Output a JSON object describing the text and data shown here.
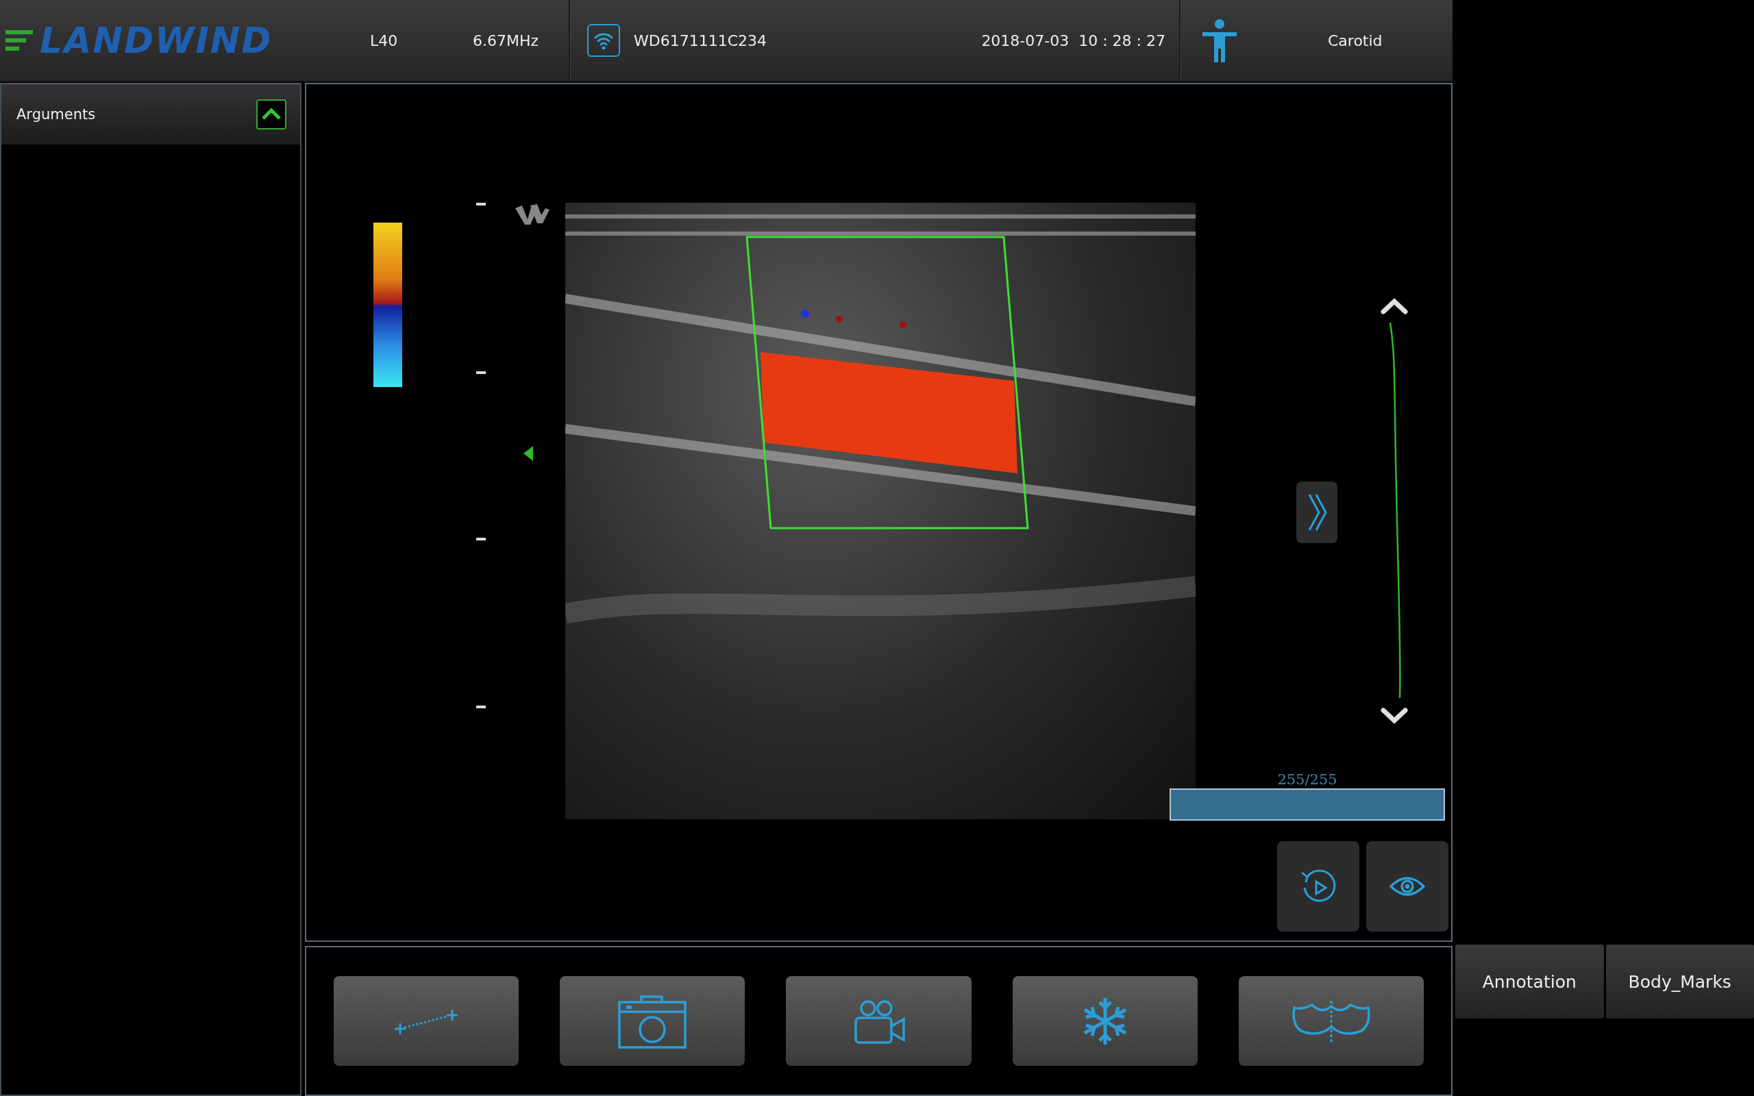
{
  "header": {
    "logo": "LANDWIND",
    "probe": "L40",
    "frequency": "6.67MHz",
    "device_id": "WD6171111C234",
    "datetime": "2018-07-03  10 : 28 : 27",
    "exam_preset": "Carotid"
  },
  "sidebar": {
    "title": "Arguments",
    "expanded": true
  },
  "cine": {
    "frame": "255/255",
    "level": 1
  },
  "toolbar": [
    {
      "kind": "measure"
    },
    {
      "kind": "camera"
    },
    {
      "kind": "video"
    },
    {
      "kind": "freeze"
    },
    {
      "kind": "bodymark"
    }
  ],
  "side_buttons": [
    "Annotation",
    "Body_Marks"
  ]
}
